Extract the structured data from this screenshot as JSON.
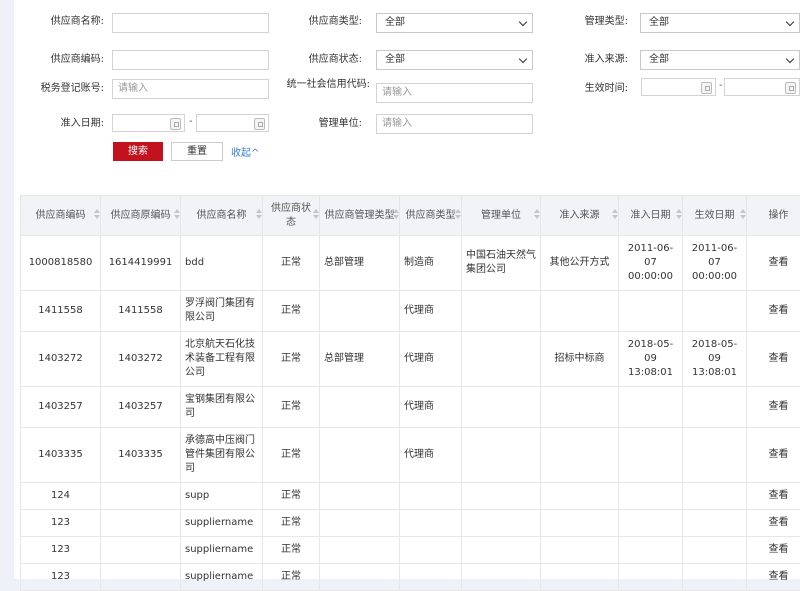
{
  "form": {
    "supplier_name_label": "供应商名称:",
    "supplier_type_label": "供应商类型:",
    "supplier_type_value": "全部",
    "manage_type_label": "管理类型:",
    "manage_type_value": "全部",
    "supplier_code_label": "供应商编码:",
    "supplier_status_label": "供应商状态:",
    "supplier_status_value": "全部",
    "source_label": "准入来源:",
    "source_value": "全部",
    "tax_label": "税务登记账号:",
    "tax_placeholder": "请输入",
    "credit_label": "统一社会信用代码:",
    "credit_placeholder": "请输入",
    "effective_label": "生效时间:",
    "date_dash": "-",
    "admit_date_label": "准入日期:",
    "manage_unit_label": "管理单位:",
    "manage_unit_placeholder": "请输入",
    "search_label": "搜索",
    "reset_label": "重置",
    "collapse_label": "收起^"
  },
  "table": {
    "headers": [
      "供应商编码",
      "供应商原编码",
      "供应商名称",
      "供应商状态",
      "供应商管理类型",
      "供应商类型",
      "管理单位",
      "准入来源",
      "准入日期",
      "生效日期",
      "操作"
    ],
    "rows": [
      {
        "code": "1000818580",
        "orig": "1614419991",
        "name": "bdd",
        "status": "正常",
        "mtype": "总部管理",
        "stype": "制造商",
        "unit": "中国石油天然气集团公司",
        "source": "其他公开方式",
        "admit": "2011-06-07 00:00:00",
        "effective": "2011-06-07 00:00:00",
        "action": "查看"
      },
      {
        "code": "1411558",
        "orig": "1411558",
        "name": "罗浮阀门集团有限公司",
        "status": "正常",
        "mtype": "",
        "stype": "代理商",
        "unit": "",
        "source": "",
        "admit": "",
        "effective": "",
        "action": "查看"
      },
      {
        "code": "1403272",
        "orig": "1403272",
        "name": "北京航天石化技术装备工程有限公司",
        "status": "正常",
        "mtype": "总部管理",
        "stype": "代理商",
        "unit": "",
        "source": "招标中标商",
        "admit": "2018-05-09 13:08:01",
        "effective": "2018-05-09 13:08:01",
        "action": "查看"
      },
      {
        "code": "1403257",
        "orig": "1403257",
        "name": "宝钢集团有限公司",
        "status": "正常",
        "mtype": "",
        "stype": "代理商",
        "unit": "",
        "source": "",
        "admit": "",
        "effective": "",
        "action": "查看"
      },
      {
        "code": "1403335",
        "orig": "1403335",
        "name": "承德高中压阀门管件集团有限公司",
        "status": "正常",
        "mtype": "",
        "stype": "代理商",
        "unit": "",
        "source": "",
        "admit": "",
        "effective": "",
        "action": "查看"
      },
      {
        "code": "124",
        "orig": "",
        "name": "supp",
        "status": "正常",
        "mtype": "",
        "stype": "",
        "unit": "",
        "source": "",
        "admit": "",
        "effective": "",
        "action": "查看"
      },
      {
        "code": "123",
        "orig": "",
        "name": "suppliername",
        "status": "正常",
        "mtype": "",
        "stype": "",
        "unit": "",
        "source": "",
        "admit": "",
        "effective": "",
        "action": "查看"
      },
      {
        "code": "123",
        "orig": "",
        "name": "suppliername",
        "status": "正常",
        "mtype": "",
        "stype": "",
        "unit": "",
        "source": "",
        "admit": "",
        "effective": "",
        "action": "查看"
      },
      {
        "code": "123",
        "orig": "",
        "name": "suppliername",
        "status": "正常",
        "mtype": "",
        "stype": "",
        "unit": "",
        "source": "",
        "admit": "",
        "effective": "",
        "action": "查看"
      }
    ]
  }
}
